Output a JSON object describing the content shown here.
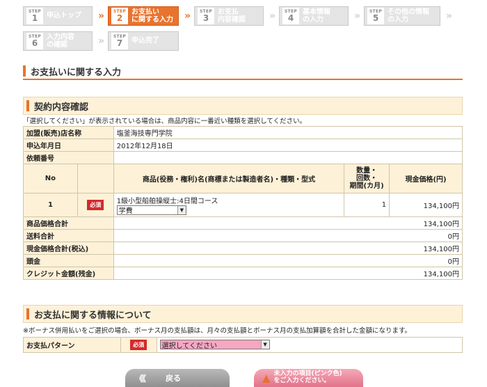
{
  "steps": {
    "row1": [
      {
        "step": "STEP",
        "num": "1",
        "label": "申込トップ",
        "active": false
      },
      {
        "step": "STEP",
        "num": "2",
        "label": "お支払い\nに関する入力",
        "active": true
      },
      {
        "step": "STEP",
        "num": "3",
        "label": "お支払\n内容確認",
        "active": false
      },
      {
        "step": "STEP",
        "num": "4",
        "label": "基本情報\nの入力",
        "active": false
      },
      {
        "step": "STEP",
        "num": "5",
        "label": "その他の情報\nの入力",
        "active": false
      }
    ],
    "row2": [
      {
        "step": "STEP",
        "num": "6",
        "label": "入力内容\nの確認",
        "active": false
      },
      {
        "step": "STEP",
        "num": "7",
        "label": "申込完了",
        "active": false
      }
    ],
    "arrow": "»"
  },
  "page_title": "お支払いに関する入力",
  "contract": {
    "title": "契約内容確認",
    "note": "「選択してください」が表示されている場合は、商品内容に一番近い種類を選択してください。",
    "store_label": "加盟(販売)店名称",
    "store_value": "塩釜海技専門学院",
    "date_label": "申込年月日",
    "date_value": "2012年12月18日",
    "request_label": "依頼番号",
    "request_value": "",
    "col_no": "No",
    "col_product": "商品(役務・権利)名(商標または製造者名)・種類・型式",
    "col_qty": "数量・\n回数・\n期間(カ月)",
    "col_price": "現金価格(円)",
    "item": {
      "no": "1",
      "required": "必須",
      "name": "1級小型船舶操縦士:4日間コース",
      "type_value": "学費",
      "qty": "1",
      "price": "134,100円"
    },
    "totals": [
      {
        "label": "商品価格合計",
        "value": "134,100円"
      },
      {
        "label": "送料合計",
        "value": "0円"
      },
      {
        "label": "現金価格合計(税込)",
        "value": "134,100円"
      },
      {
        "label": "頭金",
        "value": "0円"
      },
      {
        "label": "クレジット金額(残金)",
        "value": "134,100円"
      }
    ]
  },
  "payment": {
    "title": "お支払に関する情報について",
    "note": "※ボーナス併用払いをご選択の場合、ボーナス月の支払額は、月々の支払額とボーナス月の支払加算額を合計した金額になります。",
    "pattern_label": "お支払パターン",
    "required": "必須",
    "pattern_value": "選択してください"
  },
  "buttons": {
    "back_icon": "《《",
    "back_label": "戻る",
    "notice_label": "未入力の項目(ピンク色)\nをご入力ください。"
  },
  "colors": {
    "accent": "#e8732e",
    "required": "#d42a2a",
    "pink_field": "#f6a7c2",
    "section_bg": "#fdf1d8"
  },
  "icons": {
    "dropdown": "chevron-down-icon",
    "warning": "warning-icon",
    "back": "double-chevron-left-icon"
  }
}
